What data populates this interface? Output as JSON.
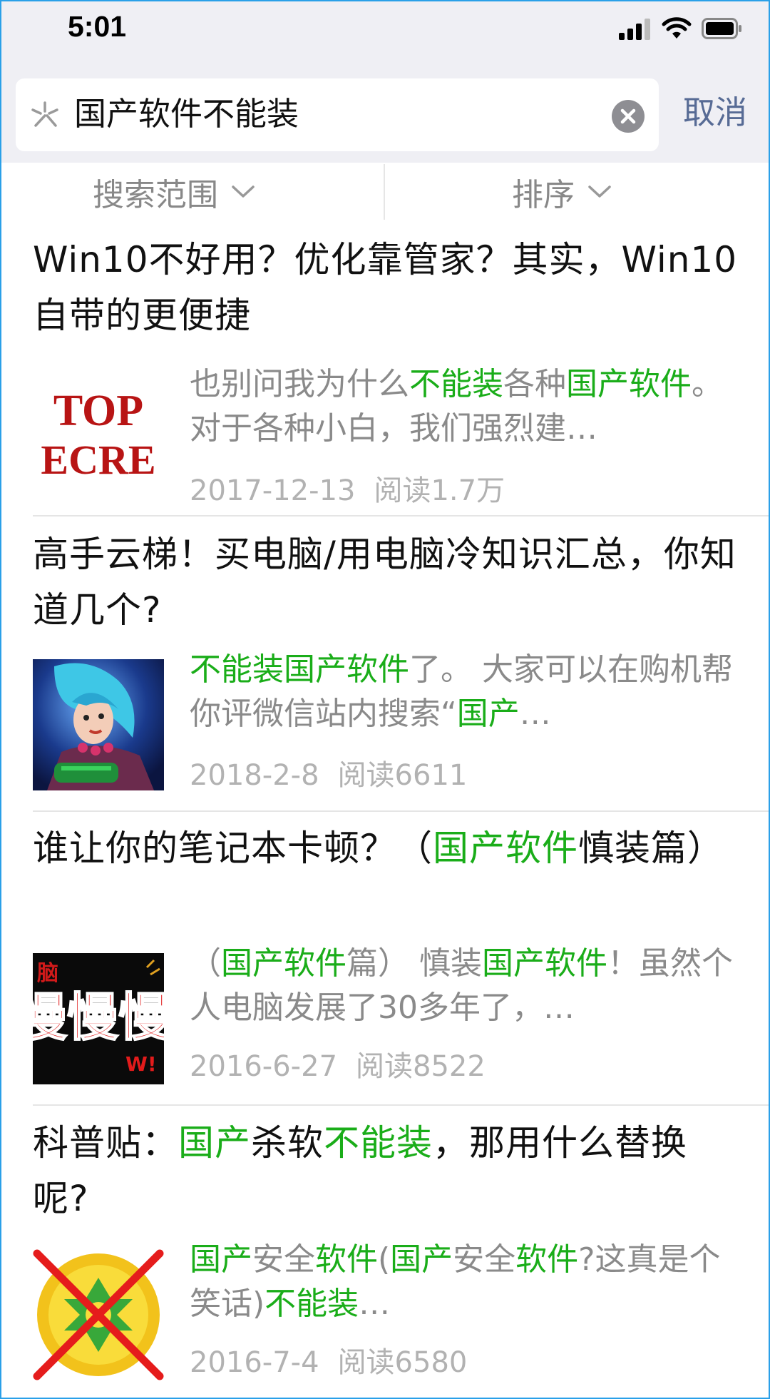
{
  "status_bar": {
    "time": "5:01"
  },
  "search": {
    "query": "国产软件不能装",
    "cancel_label": "取消"
  },
  "filters": {
    "range_label": "搜索范围",
    "sort_label": "排序"
  },
  "results": [
    {
      "title": "Win10不好用？优化靠管家？其实，Win10自带的更便捷",
      "thumb_text": [
        "TOP",
        "ECRE"
      ],
      "snippet_parts": [
        {
          "t": "也别问我为什么",
          "h": false
        },
        {
          "t": "不能装",
          "h": true
        },
        {
          "t": "各种",
          "h": false
        },
        {
          "t": "国产软件",
          "h": true
        },
        {
          "t": "。 对于各种小白，我们强烈建…",
          "h": false
        }
      ],
      "date": "2017-12-13",
      "reads": "阅读1.7万"
    },
    {
      "title": "高手云梯！买电脑/用电脑冷知识汇总，你知道几个?",
      "snippet_parts": [
        {
          "t": "不能装国产软件",
          "h": true
        },
        {
          "t": "了。 大家可以在购机帮你评微信站内搜索“",
          "h": false
        },
        {
          "t": "国产",
          "h": true
        },
        {
          "t": "…",
          "h": false
        }
      ],
      "date": "2018-2-8",
      "reads": "阅读6611"
    },
    {
      "title_parts": [
        {
          "t": "谁让你的笔记本卡顿？（",
          "h": false
        },
        {
          "t": "国产软件",
          "h": true
        },
        {
          "t": "慎装篇）",
          "h": false
        }
      ],
      "thumb_text": [
        "脑",
        "慢慢慢",
        "W!"
      ],
      "snippet_parts": [
        {
          "t": "（",
          "h": false
        },
        {
          "t": "国产软件",
          "h": true
        },
        {
          "t": "篇） 慎装",
          "h": false
        },
        {
          "t": "国产软件",
          "h": true
        },
        {
          "t": "！虽然个人电脑发展了30多年了，…",
          "h": false
        }
      ],
      "date": "2016-6-27",
      "reads": "阅读8522"
    },
    {
      "title_parts": [
        {
          "t": "科普贴：",
          "h": false
        },
        {
          "t": "国产",
          "h": true
        },
        {
          "t": "杀软",
          "h": false
        },
        {
          "t": "不能装",
          "h": true
        },
        {
          "t": "，那用什么替换呢?",
          "h": false
        }
      ],
      "snippet_parts": [
        {
          "t": "国产",
          "h": true
        },
        {
          "t": "安全",
          "h": false
        },
        {
          "t": "软件",
          "h": true
        },
        {
          "t": "(",
          "h": false
        },
        {
          "t": "国产",
          "h": true
        },
        {
          "t": "安全",
          "h": false
        },
        {
          "t": "软件",
          "h": true
        },
        {
          "t": "?这真是个笑话)",
          "h": false
        },
        {
          "t": "不能装",
          "h": true
        },
        {
          "t": "…",
          "h": false
        }
      ],
      "date": "2016-7-4",
      "reads": "阅读6580"
    }
  ],
  "colors": {
    "highlight": "#1aad19",
    "link": "#576b95",
    "meta": "#b2b2b2",
    "snippet": "#8a8a8a"
  },
  "icons": [
    "cellular-signal-icon",
    "wifi-icon",
    "battery-icon",
    "wechat-search-icon",
    "clear-icon",
    "chevron-down-icon",
    "prohibited-x-icon"
  ]
}
